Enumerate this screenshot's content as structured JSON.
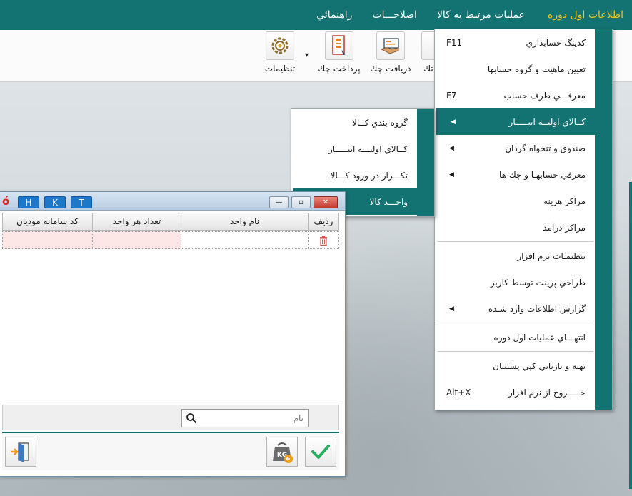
{
  "colors": {
    "teal": "#137373",
    "active_menu": "#f2c21b",
    "badge_blue": "#1d78c9",
    "pink_cell": "#fde6e6",
    "check_green": "#27ae60"
  },
  "menubar": {
    "items": [
      {
        "label": "اطلاعات اول دوره",
        "active": true
      },
      {
        "label": "عمليات مرتبط به كالا"
      },
      {
        "label": "اصلاحـــات"
      },
      {
        "label": "راهنمائي"
      }
    ]
  },
  "toolbar": {
    "buttons": [
      {
        "label": "تنظيمات",
        "icon": "gear-icon"
      },
      {
        "label": "پرداخت چك",
        "icon": "payment-check-icon"
      },
      {
        "label": "دريافت چك",
        "icon": "receive-check-icon"
      },
      {
        "label": "تك",
        "icon": "partial-icon"
      }
    ],
    "dropdown_arrow": "▾"
  },
  "main_menu": {
    "items": [
      {
        "label": "كدينگ حسابداري",
        "shortcut": "F11"
      },
      {
        "label": "تعيين ماهيت و گروه حسابها"
      },
      {
        "label": "معرفـــي طرف حساب",
        "shortcut": "F7"
      },
      {
        "label": "كــالاي اوليــه انبـــــار",
        "submenu": true,
        "highlighted": true
      },
      {
        "label": "صندوق و تنخواه گردان",
        "submenu": true
      },
      {
        "label": "معرفي حسابهـا و چك ها",
        "submenu": true
      },
      {
        "label": "مراكز هزينه"
      },
      {
        "label": "مراكز درآمد"
      },
      {
        "label": "تنظيمـات نرم افزار"
      },
      {
        "label": "طراحي پرينت توسط كاربر"
      },
      {
        "label": "گزارش اطلاعات وارد شـده",
        "submenu": true
      },
      {
        "label": "انتهـــاي عمليات اول دوره"
      },
      {
        "label": "تهيه و بازيابي كپي پشتيبان"
      },
      {
        "label": "خـــــروج از نرم افزار",
        "shortcut": "Alt+X"
      }
    ]
  },
  "sub_menu": {
    "items": [
      {
        "label": "گروه بندي كــالا"
      },
      {
        "label": "كــالاي اوليـــه انبـــــار"
      },
      {
        "label": "تكـــرار در ورود كـــالا"
      },
      {
        "label": "واحـــد كالا",
        "highlighted": true
      }
    ]
  },
  "window": {
    "badges": [
      "H",
      "K",
      "T"
    ],
    "min": "—",
    "max": "▫",
    "close": "✕",
    "columns": [
      "رديف",
      "نام واحد",
      "تعداد هر واحد",
      "كد سامانه موديان"
    ],
    "search_placeholder": "نام",
    "search_icon": "search-icon",
    "delete_icon": "trash-icon",
    "confirm_icon": "check-icon",
    "kg_icon": "kg-weight-icon",
    "kg_text": "KG",
    "exit_icon": "exit-door-icon"
  }
}
